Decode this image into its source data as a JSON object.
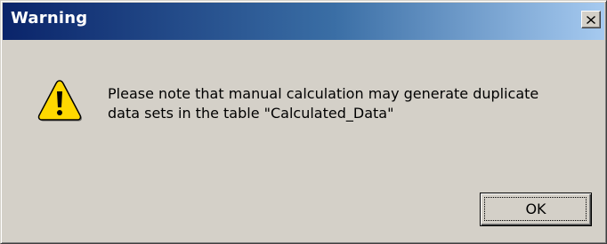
{
  "window": {
    "title": "Warning",
    "close_glyph": "✕"
  },
  "dialog": {
    "icon": "warning-triangle-icon",
    "message_line_1": "Please note that manual calculation may generate duplicate",
    "message_line_2": "data sets in the table \"Calculated_Data\""
  },
  "buttons": {
    "ok_label": "OK"
  },
  "colors": {
    "titlebar_start": "#0a246a",
    "titlebar_end": "#a6caf0",
    "face": "#d4d0c8",
    "warning_yellow": "#ffd800"
  }
}
